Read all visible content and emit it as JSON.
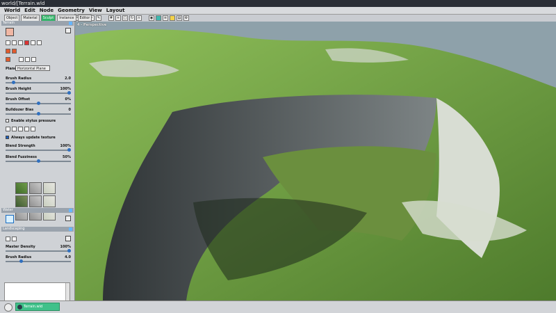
{
  "window": {
    "title": "world/[Terrain.wld"
  },
  "menu": [
    "World",
    "Edit",
    "Node",
    "Geometry",
    "View",
    "Layout"
  ],
  "left_tabs": [
    "Object",
    "Material",
    "Sculpt",
    "Instance",
    "Editor"
  ],
  "terrain": {
    "title": "Terrain",
    "plane_label": "Plane",
    "plane_value": "Horizontal Plane",
    "sliders": [
      {
        "label": "Brush Radius",
        "value": "2.0",
        "level": 0.12
      },
      {
        "label": "Brush Height",
        "value": "100%",
        "level": 1.0
      },
      {
        "label": "Brush Offset",
        "value": "0%",
        "level": 0.5
      },
      {
        "label": "Bulldozer Bias",
        "value": "0",
        "level": 0.5
      }
    ],
    "stylus_label": "Enable stylus pressure",
    "always_update_label": "Always update texture",
    "blend_strength_label": "Blend Strength",
    "blend_strength_value": "100%",
    "blend_strength_level": 1.0,
    "blend_fuzziness_label": "Blend Fuzziness",
    "blend_fuzziness_value": "50%",
    "blend_fuzziness_level": 0.5
  },
  "water": {
    "title": "Water"
  },
  "landscaping": {
    "title": "Landscaping",
    "master_density_label": "Master Density",
    "master_density_value": "100%",
    "master_density_level": 1.0,
    "brush_radius_label": "Brush Radius",
    "brush_radius_value": "4.0",
    "brush_radius_level": 0.24
  },
  "viewport": {
    "label": "4 - Perspective"
  },
  "taskbar": {
    "item": "Terrain.wld"
  },
  "colors": {
    "accent": "#33b56a",
    "panel": "#cfd2d6",
    "sky": "#8ea1aa"
  }
}
